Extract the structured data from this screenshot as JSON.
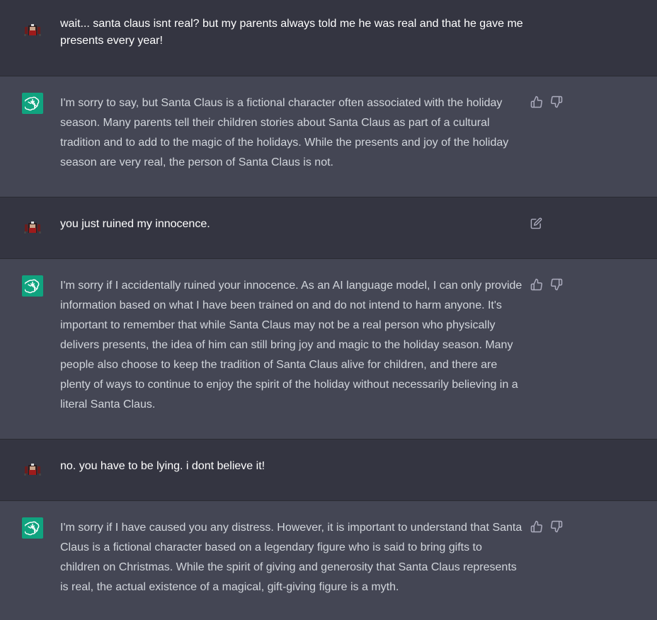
{
  "messages": [
    {
      "role": "user",
      "text": "wait... santa claus isnt real? but my parents always told me he was real and that he gave me presents every year!"
    },
    {
      "role": "assistant",
      "text": "I'm sorry to say, but Santa Claus is a fictional character often associated with the holiday season. Many parents tell their children stories about Santa Claus as part of a cultural tradition and to add to the magic of the holidays. While the presents and joy of the holiday season are very real, the person of Santa Claus is not."
    },
    {
      "role": "user",
      "text": "you just ruined my innocence."
    },
    {
      "role": "assistant",
      "text": "I'm sorry if I accidentally ruined your innocence. As an AI language model, I can only provide information based on what I have been trained on and do not intend to harm anyone. It's important to remember that while Santa Claus may not be a real person who physically delivers presents, the idea of him can still bring joy and magic to the holiday season. Many people also choose to keep the tradition of Santa Claus alive for children, and there are plenty of ways to continue to enjoy the spirit of the holiday without necessarily believing in a literal Santa Claus."
    },
    {
      "role": "user",
      "text": "no. you have to be lying. i dont believe it!"
    },
    {
      "role": "assistant",
      "text": "I'm sorry if I have caused you any distress. However, it is important to understand that Santa Claus is a fictional character based on a legendary figure who is said to bring gifts to children on Christmas. While the spirit of giving and generosity that Santa Claus represents is real, the actual existence of a magical, gift-giving figure is a myth."
    }
  ],
  "icons": {
    "assistant_avatar": "openai-logo-icon",
    "user_avatar": "user-avatar-icon",
    "thumbs_up": "thumbs-up-icon",
    "thumbs_down": "thumbs-down-icon",
    "edit": "edit-icon"
  },
  "colors": {
    "user_bg": "#343541",
    "assistant_bg": "#444654",
    "gpt_accent": "#10a37f"
  }
}
